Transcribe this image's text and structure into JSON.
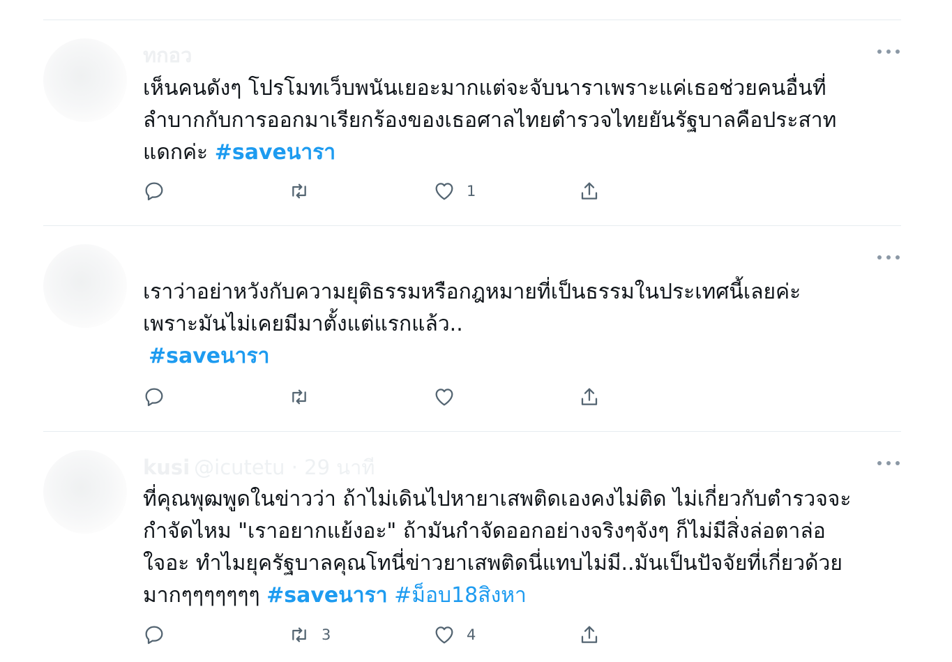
{
  "tweets": [
    {
      "author": "ทกอว",
      "handle": "",
      "text_lines": [
        "เห็นคนดังๆ โปรโมทเว็บพนันเยอะมากแต่จะจับนาราเพราะแค่เธอช่วยคนอื่นที่",
        "ลำบากกับการออกมาเรียกร้องของเธอศาลไทยตำรวจไทยยันรัฐบาลคือประสาท",
        "แดกค่ะ "
      ],
      "hashtags": [
        "#saveนารา"
      ],
      "reply_count": "",
      "retweet_count": "",
      "like_count": "1"
    },
    {
      "author": "",
      "handle": "",
      "text_lines": [
        "เราว่าอย่าหวังกับความยุติธรรมหรือกฎหมายที่เป็นธรรมในประเทศนี้เลยค่ะ",
        "เพราะมันไม่เคยมีมาตั้งแต่แรกแล้ว.."
      ],
      "hashtags": [
        "#saveนารา"
      ],
      "reply_count": "",
      "retweet_count": "",
      "like_count": ""
    },
    {
      "author": "kusi",
      "handle": "@icutetu · 29 นาที",
      "text_lines": [
        "ที่คุณพุฒพูดในข่าวว่า ถ้าไม่เดินไปหายาเสพติดเองคงไม่ติด ไม่เกี่ยวกับตำรวจจะ",
        "กำจัดไหม \"เราอยากแย้งอะ\" ถ้ามันกำจัดออกอย่างจริงๆจังๆ ก็ไม่มีสิ่งล่อตาล่อ",
        "ใจอะ ทำไมยุครัฐบาลคุณโทนี่ข่าวยาเสพติดนี่แทบไม่มี..มันเป็นปัจจัยที่เกี่ยวด้วย",
        "มากๆๆๆๆๆๆๆ "
      ],
      "hashtags": [
        "#saveนารา",
        "#ม็อบ18สิงหา"
      ],
      "reply_count": "",
      "retweet_count": "3",
      "like_count": "4"
    }
  ],
  "icons": {
    "more": "more-horizontal-icon",
    "reply": "reply-icon",
    "retweet": "retweet-icon",
    "like": "heart-icon",
    "share": "share-icon"
  },
  "colors": {
    "hashtag": "#1d9bf0",
    "icon": "#536471",
    "divider": "#e6ecf0"
  }
}
